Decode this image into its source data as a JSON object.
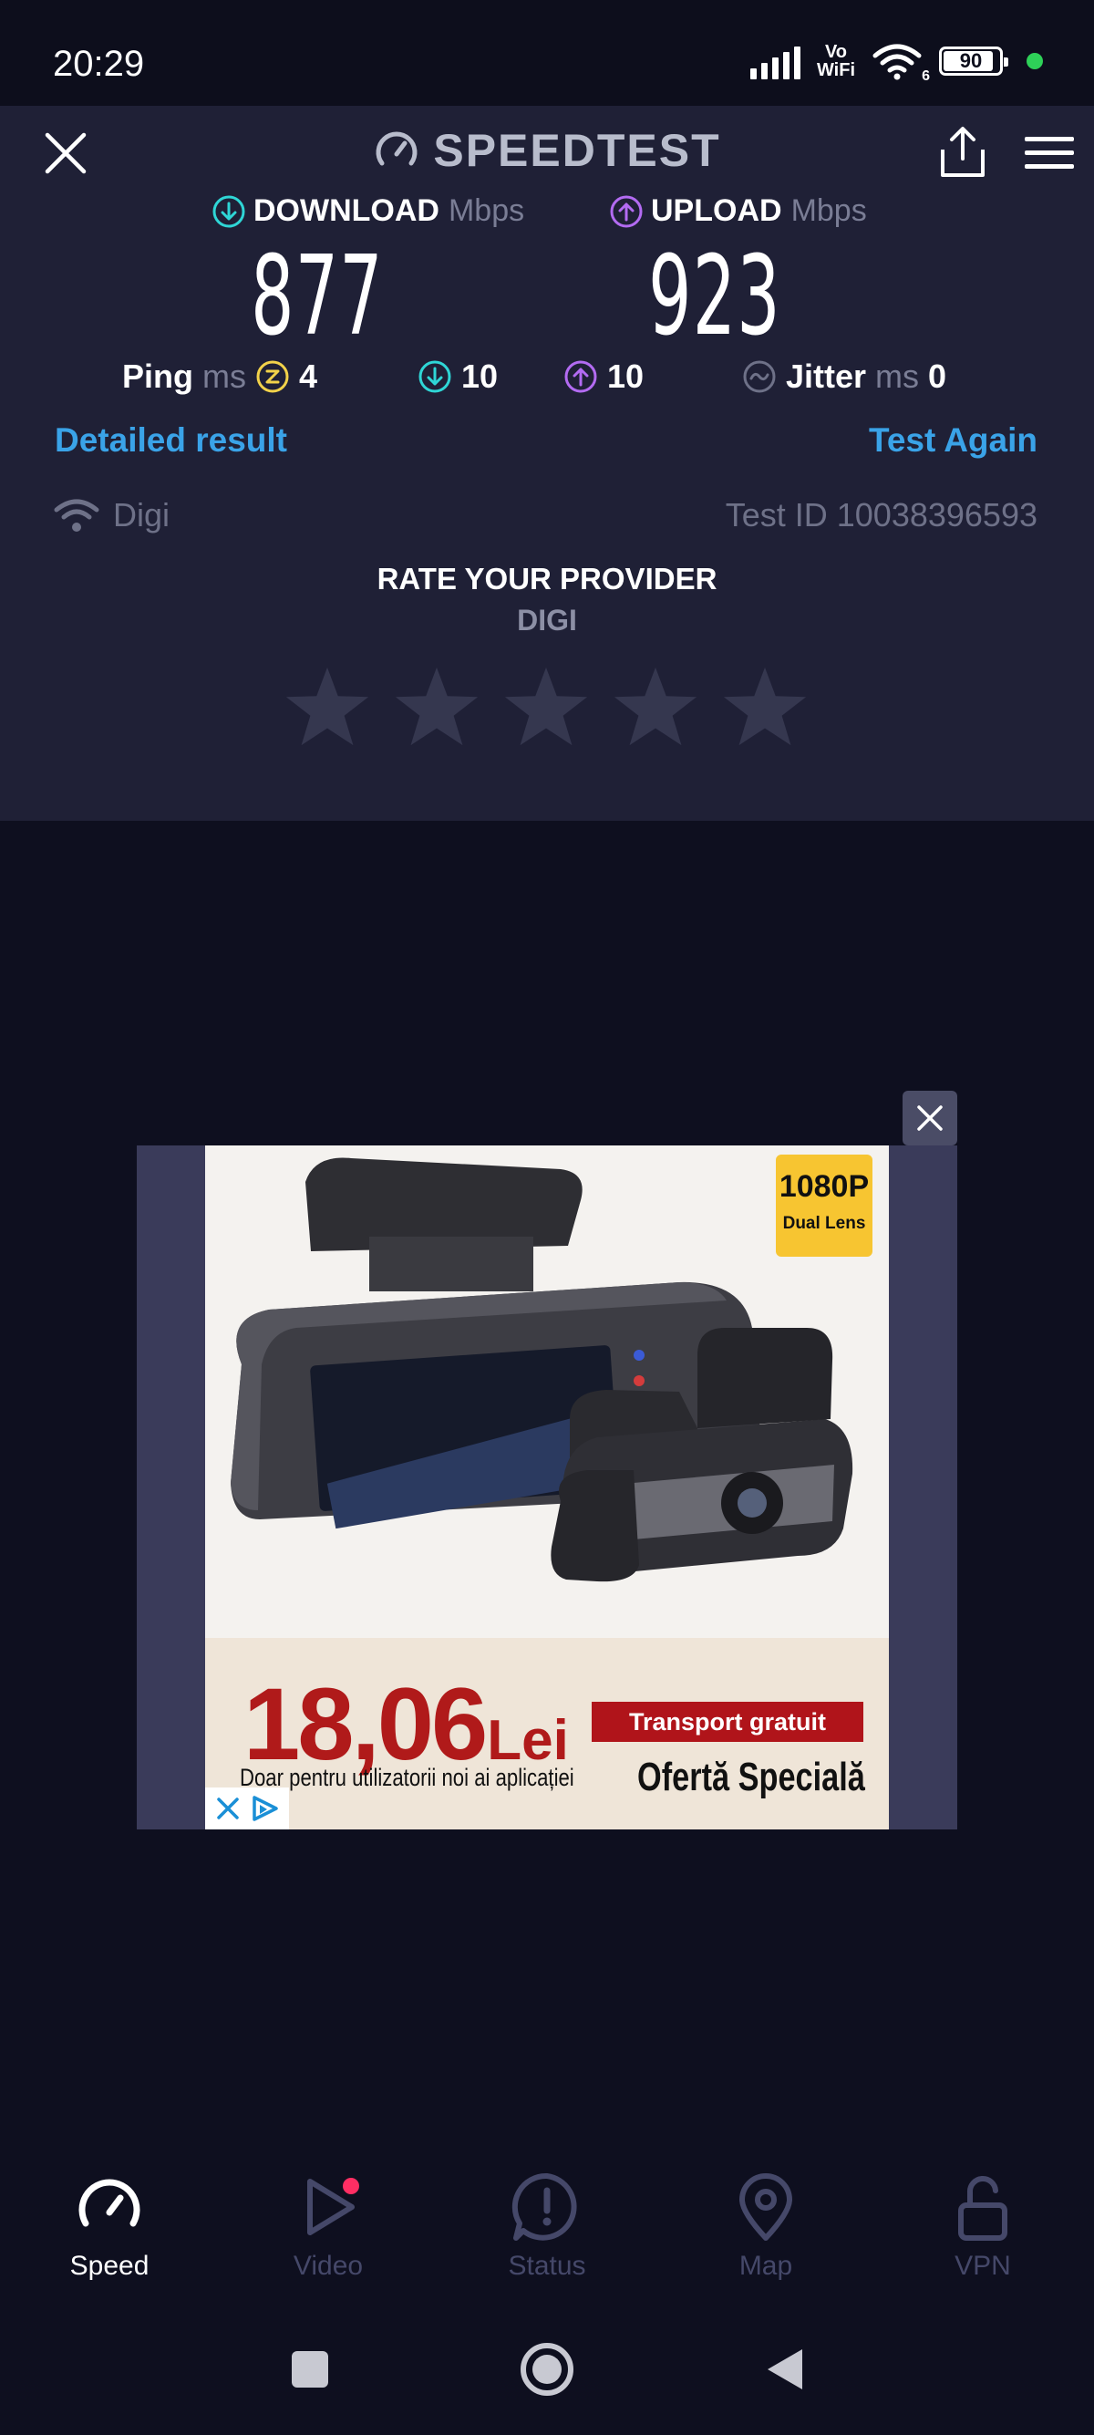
{
  "status_bar": {
    "time": "20:29",
    "vowifi_top": "Vo",
    "vowifi_bottom": "WiFi",
    "wifi_badge": "6",
    "battery": "90",
    "battery_level": 0.9
  },
  "header": {
    "title": "SPEEDTEST"
  },
  "results": {
    "download_label": "DOWNLOAD",
    "upload_label": "UPLOAD",
    "unit": "Mbps",
    "download_value": "877",
    "upload_value": "923",
    "ping_label": "Ping",
    "ping_unit": "ms",
    "ping_idle": "4",
    "ping_download": "10",
    "ping_upload": "10",
    "jitter_label": "Jitter",
    "jitter_unit": "ms",
    "jitter_value": "0"
  },
  "links": {
    "detailed_result": "Detailed result",
    "test_again": "Test Again"
  },
  "provider": {
    "name": "Digi",
    "test_id": "Test ID 10038396593"
  },
  "rating": {
    "title": "RATE YOUR PROVIDER",
    "provider": "DIGI",
    "star_count": 5,
    "rating_value": 0
  },
  "ad": {
    "badge_big": "1080P",
    "badge_small": "Dual Lens",
    "price_number": "18,06",
    "price_currency": "Lei",
    "transport": "Transport gratuit",
    "note": "Doar pentru utilizatorii noi ai aplicației",
    "special": "Ofertă Specială"
  },
  "bottom_nav": {
    "items": [
      {
        "label": "Speed",
        "icon": "speedometer-icon",
        "active": true
      },
      {
        "label": "Video",
        "icon": "play-icon",
        "active": false
      },
      {
        "label": "Status",
        "icon": "alert-icon",
        "active": false
      },
      {
        "label": "Map",
        "icon": "map-pin-icon",
        "active": false
      },
      {
        "label": "VPN",
        "icon": "lock-icon",
        "active": false
      }
    ]
  },
  "colors": {
    "accent": "#3aa3e8",
    "download": "#2fd6d6",
    "upload": "#b36bf2",
    "ping": "#f2d24a",
    "panel": "#1f2036",
    "background": "#0e0f1f"
  }
}
